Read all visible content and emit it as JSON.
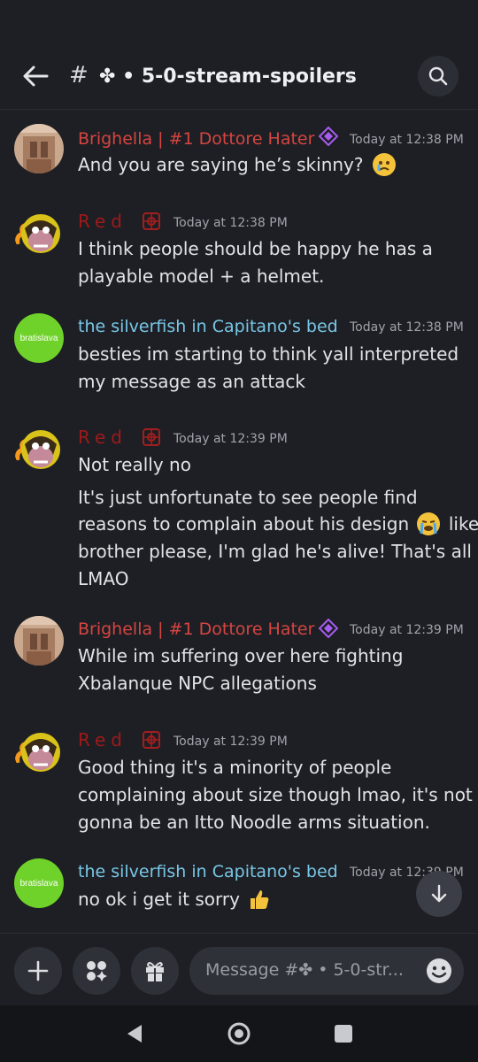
{
  "header": {
    "back_label": "Back",
    "hash": "#",
    "channel_name": "✤ • 5-0-stream-spoilers",
    "chevron": "›"
  },
  "messages": [
    {
      "author": "Brighella | #1 Dottore Hater",
      "timestamp": "Today at 12:38 PM",
      "lines": [
        "And you are saying he’s skinny?"
      ],
      "emoji": "sad-face-emoji"
    },
    {
      "author": "Red",
      "timestamp": "Today at 12:38 PM",
      "lines": [
        "I think people should be happy he has a",
        "playable model + a helmet."
      ]
    },
    {
      "author": "the silverfish in Capitano's bed",
      "timestamp": "Today at 12:38 PM",
      "avatar_text": "bratislava",
      "lines": [
        "besties im starting to think yall interpreted",
        "my message as an attack"
      ]
    },
    {
      "author": "Red",
      "timestamp": "Today at 12:39 PM",
      "lines": [
        "Not really no"
      ],
      "lines2": [
        "It's just unfortunate to see people find",
        "reasons to complain about his design",
        "like",
        "brother please, I'm glad he's alive! That's all",
        "LMAO"
      ],
      "emoji": "loudly-crying-emoji"
    },
    {
      "author": "Brighella | #1 Dottore Hater",
      "timestamp": "Today at 12:39 PM",
      "lines": [
        "While im suffering over here fighting",
        "Xbalanque NPC allegations"
      ]
    },
    {
      "author": "Red",
      "timestamp": "Today at 12:39 PM",
      "lines": [
        "Good thing it's a minority of people",
        "complaining about size though lmao, it's not",
        "gonna be an Itto Noodle arms situation."
      ]
    },
    {
      "author": "the silverfish in Capitano's bed",
      "timestamp": "Today at 12:39 PM",
      "avatar_text": "bratislava",
      "lines": [
        "no ok i get it sorry"
      ],
      "emoji": "thumbs-up-emoji"
    }
  ],
  "composer": {
    "placeholder": "Message #✤ • 5-0-str..."
  },
  "colors": {
    "background": "#1e1f24",
    "brighella_name": "#d64541",
    "red_name": "#9e1a1a",
    "silverfish_name": "#78c7e6",
    "timestamp": "#a0a3ab"
  }
}
